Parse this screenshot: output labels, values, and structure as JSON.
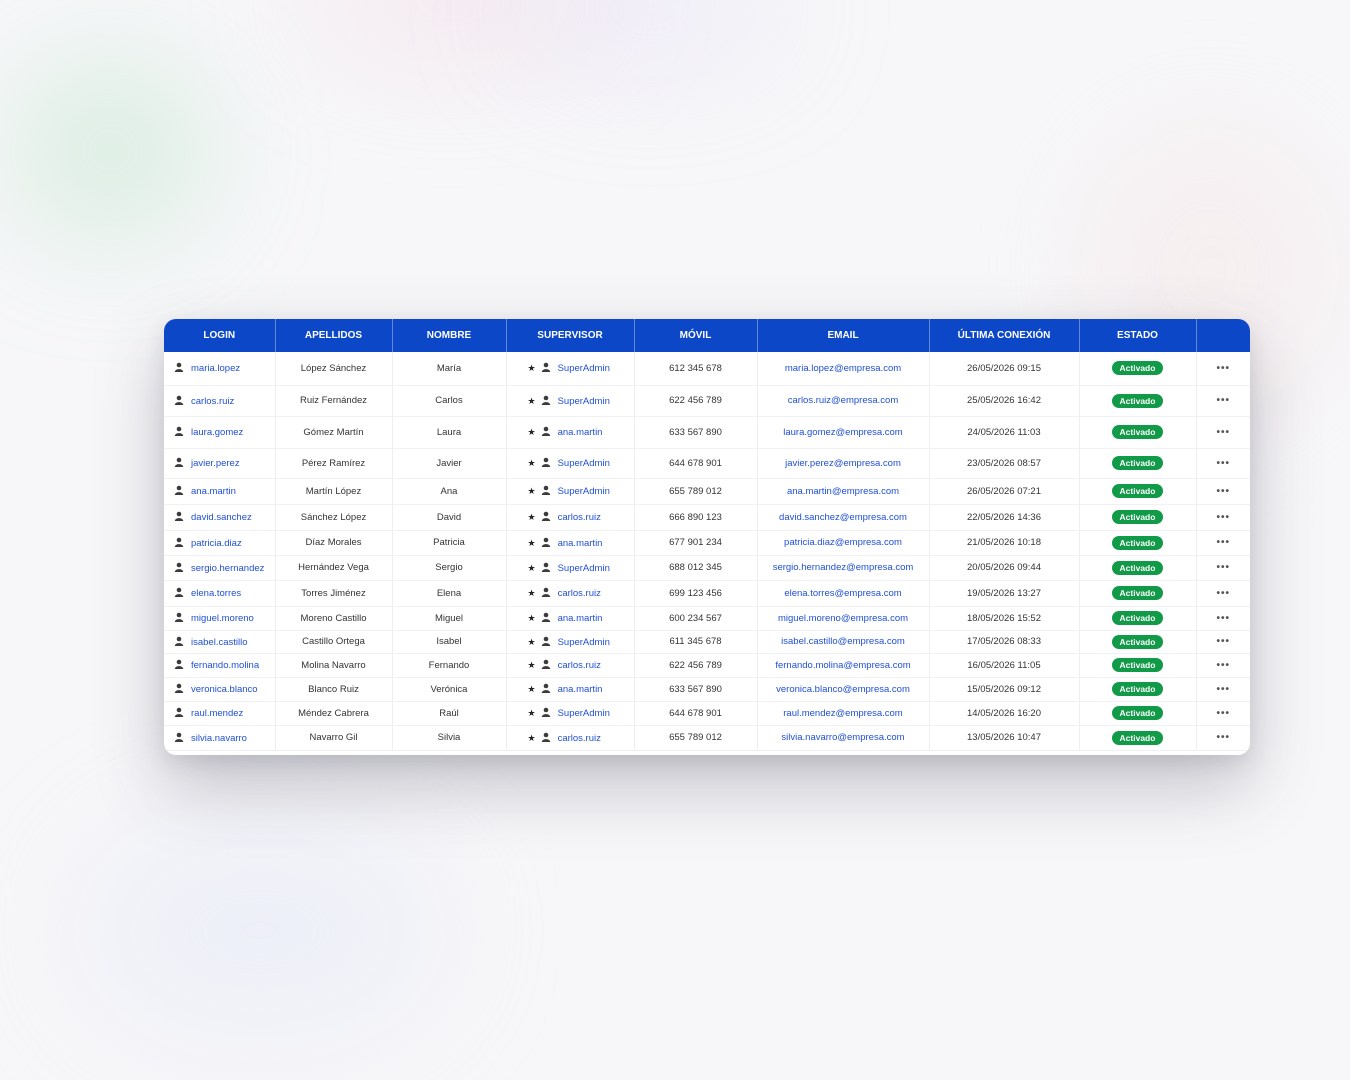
{
  "headers": [
    "LOGIN",
    "APELLIDOS",
    "NOMBRE",
    "SUPERVISOR",
    "MÓVIL",
    "EMAIL",
    "ÚLTIMA CONEXIÓN",
    "ESTADO"
  ],
  "rows": [
    {
      "login": "maria.lopez",
      "apellidos": "López Sánchez",
      "nombre": "María",
      "supervisor": "SuperAdmin",
      "movil": "612 345 678",
      "email": "maria.lopez@empresa.com",
      "ultima": "26/05/2026 09:15",
      "estado": "Activado"
    },
    {
      "login": "carlos.ruiz",
      "apellidos": "Ruiz Fernández",
      "nombre": "Carlos",
      "supervisor": "SuperAdmin",
      "movil": "622 456 789",
      "email": "carlos.ruiz@empresa.com",
      "ultima": "25/05/2026 16:42",
      "estado": "Activado"
    },
    {
      "login": "laura.gomez",
      "apellidos": "Gómez Martín",
      "nombre": "Laura",
      "supervisor": "ana.martin",
      "movil": "633 567 890",
      "email": "laura.gomez@empresa.com",
      "ultima": "24/05/2026 11:03",
      "estado": "Activado"
    },
    {
      "login": "javier.perez",
      "apellidos": "Pérez Ramírez",
      "nombre": "Javier",
      "supervisor": "SuperAdmin",
      "movil": "644 678 901",
      "email": "javier.perez@empresa.com",
      "ultima": "23/05/2026 08:57",
      "estado": "Activado"
    },
    {
      "login": "ana.martin",
      "apellidos": "Martín López",
      "nombre": "Ana",
      "supervisor": "SuperAdmin",
      "movil": "655 789 012",
      "email": "ana.martin@empresa.com",
      "ultima": "26/05/2026 07:21",
      "estado": "Activado"
    },
    {
      "login": "david.sanchez",
      "apellidos": "Sánchez López",
      "nombre": "David",
      "supervisor": "carlos.ruiz",
      "movil": "666 890 123",
      "email": "david.sanchez@empresa.com",
      "ultima": "22/05/2026 14:36",
      "estado": "Activado"
    },
    {
      "login": "patricia.diaz",
      "apellidos": "Díaz Morales",
      "nombre": "Patricia",
      "supervisor": "ana.martin",
      "movil": "677 901 234",
      "email": "patricia.diaz@empresa.com",
      "ultima": "21/05/2026 10:18",
      "estado": "Activado"
    },
    {
      "login": "sergio.hernandez",
      "apellidos": "Hernández Vega",
      "nombre": "Sergio",
      "supervisor": "SuperAdmin",
      "movil": "688 012 345",
      "email": "sergio.hernandez@empresa.com",
      "ultima": "20/05/2026 09:44",
      "estado": "Activado"
    },
    {
      "login": "elena.torres",
      "apellidos": "Torres Jiménez",
      "nombre": "Elena",
      "supervisor": "carlos.ruiz",
      "movil": "699 123 456",
      "email": "elena.torres@empresa.com",
      "ultima": "19/05/2026 13:27",
      "estado": "Activado"
    },
    {
      "login": "miguel.moreno",
      "apellidos": "Moreno Castillo",
      "nombre": "Miguel",
      "supervisor": "ana.martin",
      "movil": "600 234 567",
      "email": "miguel.moreno@empresa.com",
      "ultima": "18/05/2026 15:52",
      "estado": "Activado"
    },
    {
      "login": "isabel.castillo",
      "apellidos": "Castillo Ortega",
      "nombre": "Isabel",
      "supervisor": "SuperAdmin",
      "movil": "611 345 678",
      "email": "isabel.castillo@empresa.com",
      "ultima": "17/05/2026 08:33",
      "estado": "Activado"
    },
    {
      "login": "fernando.molina",
      "apellidos": "Molina Navarro",
      "nombre": "Fernando",
      "supervisor": "carlos.ruiz",
      "movil": "622 456 789",
      "email": "fernando.molina@empresa.com",
      "ultima": "16/05/2026 11:05",
      "estado": "Activado"
    },
    {
      "login": "veronica.blanco",
      "apellidos": "Blanco Ruiz",
      "nombre": "Verónica",
      "supervisor": "ana.martin",
      "movil": "633 567 890",
      "email": "veronica.blanco@empresa.com",
      "ultima": "15/05/2026 09:12",
      "estado": "Activado"
    },
    {
      "login": "raul.mendez",
      "apellidos": "Méndez Cabrera",
      "nombre": "Raúl",
      "supervisor": "SuperAdmin",
      "movil": "644 678 901",
      "email": "raul.mendez@empresa.com",
      "ultima": "14/05/2026 16:20",
      "estado": "Activado"
    },
    {
      "login": "silvia.navarro",
      "apellidos": "Navarro Gil",
      "nombre": "Silvia",
      "supervisor": "carlos.ruiz",
      "movil": "655 789 012",
      "email": "silvia.navarro@empresa.com",
      "ultima": "13/05/2026 10:47",
      "estado": "Activado"
    }
  ],
  "icons": {
    "login": "user-icon",
    "supervisor_star": "star-icon",
    "supervisor_user": "user-icon",
    "actions": "more-icon"
  },
  "colors": {
    "header_bg": "#0b47c7",
    "link": "#1f4fd6",
    "badge_active": "#119a48"
  }
}
